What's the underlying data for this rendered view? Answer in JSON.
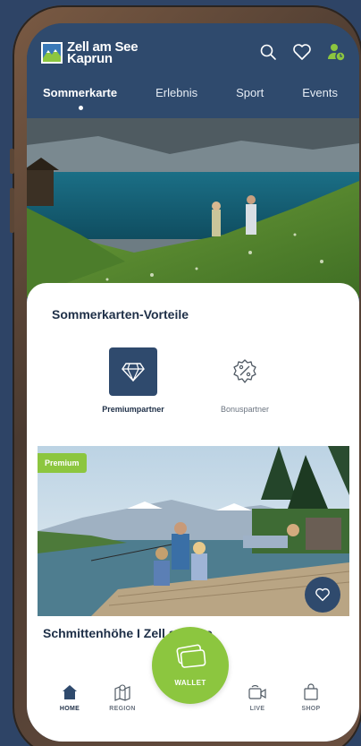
{
  "app": {
    "logo_line1": "Zell am See",
    "logo_line2": "Kaprun"
  },
  "header_icons": [
    "search-icon",
    "heart-icon",
    "user-icon"
  ],
  "tabs": [
    {
      "label": "Sommerkarte",
      "active": true
    },
    {
      "label": "Erlebnis",
      "active": false
    },
    {
      "label": "Sport",
      "active": false
    },
    {
      "label": "Events",
      "active": false
    }
  ],
  "section": {
    "title": "Sommerkarten-Vorteile"
  },
  "partners": [
    {
      "label": "Premiumpartner",
      "icon": "diamond-icon",
      "active": true
    },
    {
      "label": "Bonuspartner",
      "icon": "percent-badge-icon",
      "active": false
    }
  ],
  "promo": {
    "badge": "Premium",
    "title": "Schmittenhöhe I Zell am See"
  },
  "bottom_nav": {
    "home": "HOME",
    "region": "REGION",
    "wallet": "WALLET",
    "live": "LIVE",
    "shop": "SHOP"
  },
  "colors": {
    "brand_navy": "#2f4a6d",
    "accent_green": "#8cc63f",
    "frame_bronze": "#6b5040"
  }
}
